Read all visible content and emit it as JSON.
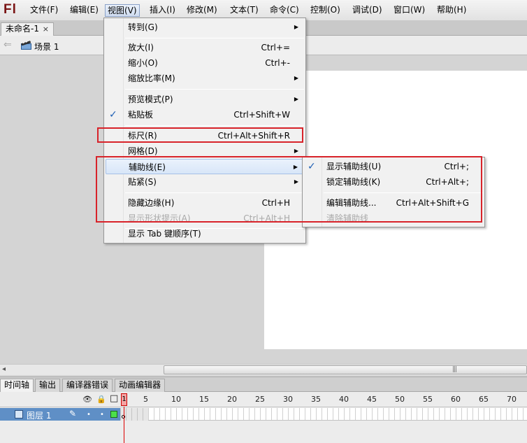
{
  "app": {
    "logo": "Fl"
  },
  "menubar": {
    "items": [
      {
        "label": "文件(F)"
      },
      {
        "label": "编辑(E)"
      },
      {
        "label": "视图(V)"
      },
      {
        "label": "插入(I)"
      },
      {
        "label": "修改(M)"
      },
      {
        "label": "文本(T)"
      },
      {
        "label": "命令(C)"
      },
      {
        "label": "控制(O)"
      },
      {
        "label": "调试(D)"
      },
      {
        "label": "窗口(W)"
      },
      {
        "label": "帮助(H)"
      }
    ]
  },
  "document": {
    "tab_label": "未命名-1",
    "close_glyph": "×"
  },
  "scene": {
    "back_glyph": "⇐",
    "label": "场景 1"
  },
  "view_menu": {
    "items": [
      {
        "label": "转到(G)",
        "shortcut": "",
        "submenu": "▶"
      },
      {
        "label": "放大(I)",
        "shortcut": "Ctrl+="
      },
      {
        "label": "缩小(O)",
        "shortcut": "Ctrl+-"
      },
      {
        "label": "缩放比率(M)",
        "shortcut": "",
        "submenu": "▶"
      },
      {
        "label": "预览模式(P)",
        "shortcut": "",
        "submenu": "▶"
      },
      {
        "label": "粘贴板",
        "shortcut": "Ctrl+Shift+W",
        "checked": "✓"
      },
      {
        "label": "标尺(R)",
        "shortcut": "Ctrl+Alt+Shift+R"
      },
      {
        "label": "网格(D)",
        "shortcut": "",
        "submenu": "▶"
      },
      {
        "label": "辅助线(E)",
        "shortcut": "",
        "submenu": "▶"
      },
      {
        "label": "贴紧(S)",
        "shortcut": "",
        "submenu": "▶"
      },
      {
        "label": "隐藏边缘(H)",
        "shortcut": "Ctrl+H"
      },
      {
        "label": "显示形状提示(A)",
        "shortcut": "Ctrl+Alt+H"
      },
      {
        "label": "显示 Tab 键顺序(T)",
        "shortcut": ""
      }
    ]
  },
  "guides_submenu": {
    "items": [
      {
        "label": "显示辅助线(U)",
        "shortcut": "Ctrl+;",
        "checked": "✓"
      },
      {
        "label": "锁定辅助线(K)",
        "shortcut": "Ctrl+Alt+;"
      },
      {
        "label": "编辑辅助线...",
        "shortcut": "Ctrl+Alt+Shift+G"
      },
      {
        "label": "清除辅助线",
        "shortcut": ""
      }
    ]
  },
  "scrollbar": {
    "left_glyph": "◂",
    "grip": "|||"
  },
  "panels": {
    "tabs": [
      {
        "label": "时间轴"
      },
      {
        "label": "输出"
      },
      {
        "label": "编译器错误"
      },
      {
        "label": "动画编辑器"
      }
    ]
  },
  "timeline": {
    "header_icons": {
      "eye": "👁",
      "lock": "🔒",
      "outline": "□"
    },
    "frame_numbers": [
      "1",
      "5",
      "10",
      "15",
      "20",
      "25",
      "30",
      "35",
      "40",
      "45",
      "50",
      "55",
      "60",
      "65",
      "70"
    ],
    "layer": {
      "name": "图层 1",
      "pencil": "✎",
      "dot": "•"
    },
    "current_frame": "1"
  },
  "colors": {
    "highlight_red": "#d8232a",
    "layer_blue": "#5f8fc6",
    "stage": "#ffffff"
  }
}
